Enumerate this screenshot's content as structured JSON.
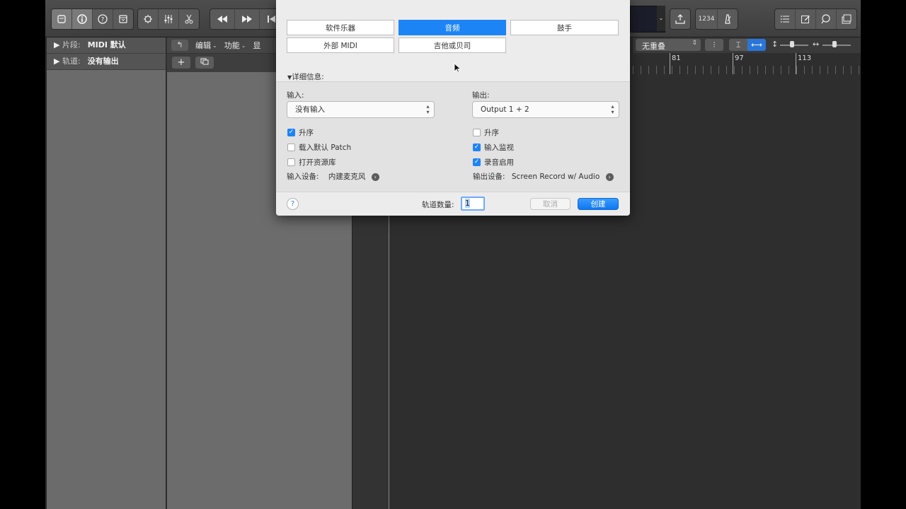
{
  "toolbar": {
    "counter_label": "1234"
  },
  "inspector": {
    "region": {
      "label": "片段:",
      "value": "MIDI 默认"
    },
    "track": {
      "label": "轨道:",
      "value": "没有输出"
    }
  },
  "tracks_menu": {
    "items": [
      "编辑",
      "功能",
      "显"
    ],
    "add_label": "+"
  },
  "arrange": {
    "snap_value": "无重叠",
    "ruler_numbers": [
      "81",
      "97",
      "113"
    ]
  },
  "dialog": {
    "track_types": [
      "软件乐器",
      "音频",
      "鼓手",
      "外部 MIDI",
      "吉他或贝司"
    ],
    "selected_type": "音频",
    "details_label": "详细信息:",
    "input": {
      "label": "输入:",
      "value": "没有输入",
      "ascending_label": "升序",
      "ascending_checked": true,
      "load_patch_label": "载入默认 Patch",
      "load_patch_checked": false,
      "open_library_label": "打开资源库",
      "open_library_checked": false,
      "device_label": "输入设备:",
      "device_value": "内建麦克风"
    },
    "output": {
      "label": "输出:",
      "value": "Output 1 + 2",
      "ascending_label": "升序",
      "ascending_checked": false,
      "monitor_label": "输入监视",
      "monitor_checked": true,
      "record_enable_label": "录音启用",
      "record_enable_checked": true,
      "device_label": "输出设备:",
      "device_value": "Screen Record w/ Audio"
    },
    "help_label": "?",
    "count_label": "轨道数量:",
    "count_value": "1",
    "cancel_label": "取消",
    "create_label": "创建"
  }
}
